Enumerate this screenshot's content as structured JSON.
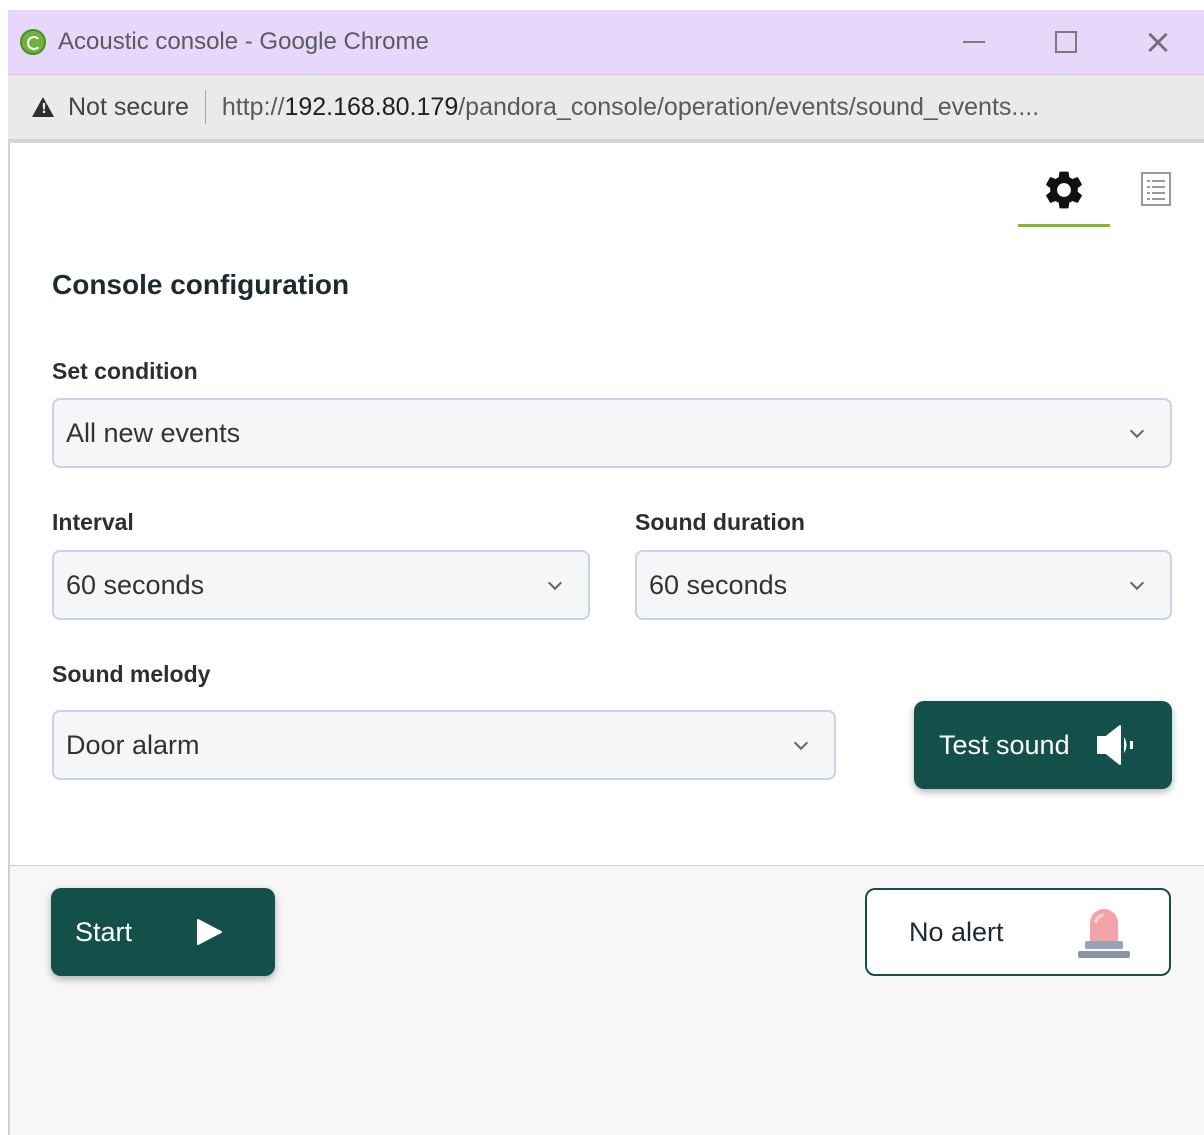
{
  "window": {
    "title": "Acoustic console - Google Chrome",
    "controls": {
      "minimize": "minimize",
      "maximize": "maximize",
      "close": "close"
    }
  },
  "address_bar": {
    "security_label": "Not secure",
    "url_prefix": "http://",
    "url_host": "192.168.80.179",
    "url_path": "/pandora_console/operation/events/sound_events...."
  },
  "tabs": [
    {
      "name": "settings",
      "icon": "gear-icon",
      "active": true
    },
    {
      "name": "list",
      "icon": "list-icon",
      "active": false
    }
  ],
  "config": {
    "heading": "Console configuration",
    "set_condition": {
      "label": "Set condition",
      "value": "All new events"
    },
    "interval": {
      "label": "Interval",
      "value": "60 seconds"
    },
    "sound_duration": {
      "label": "Sound duration",
      "value": "60 seconds"
    },
    "sound_melody": {
      "label": "Sound melody",
      "value": "Door alarm"
    },
    "test_sound_label": "Test sound"
  },
  "footer": {
    "start_label": "Start",
    "alert_status": "No alert"
  },
  "colors": {
    "accent_green": "#82b92e",
    "button_dark": "#14504a",
    "titlebar": "#e6d7fb"
  }
}
